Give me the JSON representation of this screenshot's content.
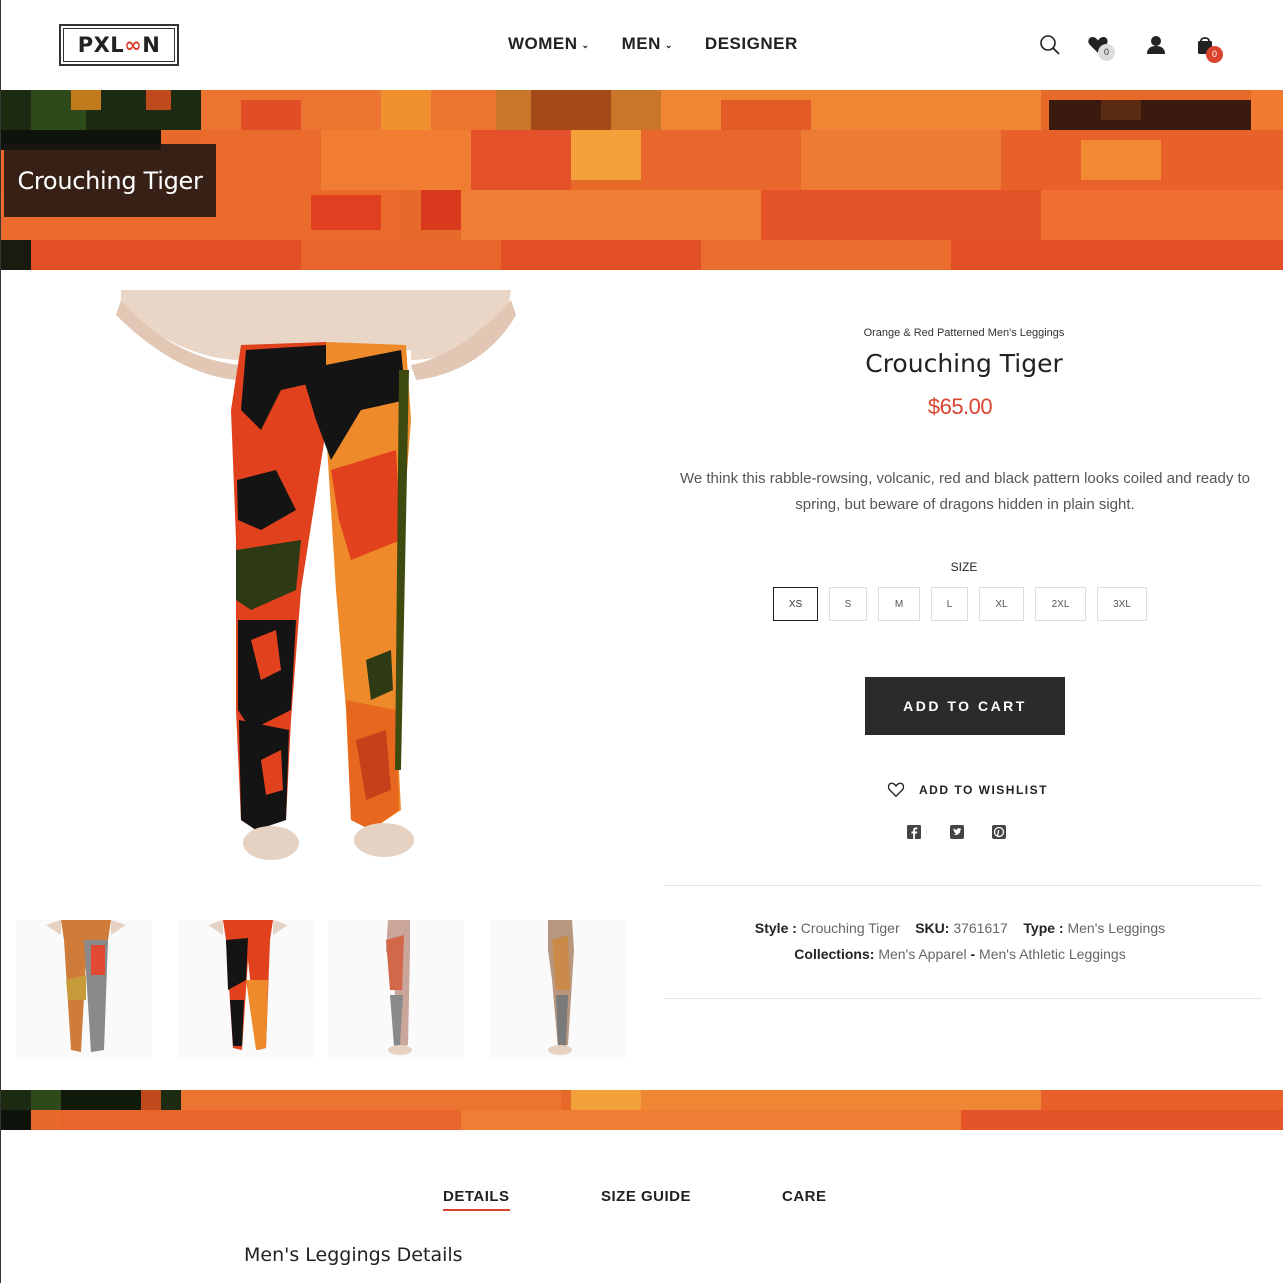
{
  "brand": {
    "logo_left": "PXL",
    "logo_oo": "∞",
    "logo_right": "N"
  },
  "nav": {
    "women": "WOMEN",
    "men": "MEN",
    "designer": "DESIGNER"
  },
  "header_icons": {
    "search": "search-icon",
    "wishlist": "heart-icon",
    "wishlist_count": "0",
    "account": "user-icon",
    "cart": "bag-icon",
    "cart_count": "0"
  },
  "banner": {
    "title": "Crouching Tiger"
  },
  "product": {
    "subtitle": "Orange & Red Patterned Men's Leggings",
    "title": "Crouching Tiger",
    "price": "$65.00",
    "description": "We think this rabble-rowsing, volcanic, red and black pattern looks coiled and ready to spring, but beware of dragons hidden in plain sight.",
    "size_label": "SIZE",
    "sizes": [
      "XS",
      "S",
      "M",
      "L",
      "XL",
      "2XL",
      "3XL"
    ],
    "selected_size": "XS",
    "add_to_cart": "ADD TO CART",
    "add_to_wishlist": "ADD TO WISHLIST"
  },
  "social": [
    "facebook-icon",
    "twitter-icon",
    "pinterest-icon"
  ],
  "meta": {
    "style_label": "Style :",
    "style_value": "Crouching Tiger",
    "sku_label": "SKU:",
    "sku_value": "3761617",
    "type_label": "Type :",
    "type_value": "Men's Leggings",
    "collections_label": "Collections:",
    "collection_1": "Men's Apparel",
    "separator": "-",
    "collection_2": "Men's Athletic Leggings"
  },
  "tabs": {
    "details": "DETAILS",
    "size_guide": "SIZE GUIDE",
    "care": "CARE"
  },
  "details": {
    "title": "Men's Leggings Details"
  },
  "colors": {
    "accent": "#d9442f",
    "dark": "#2b2b2b",
    "banner_orange": "#e86a2a"
  }
}
